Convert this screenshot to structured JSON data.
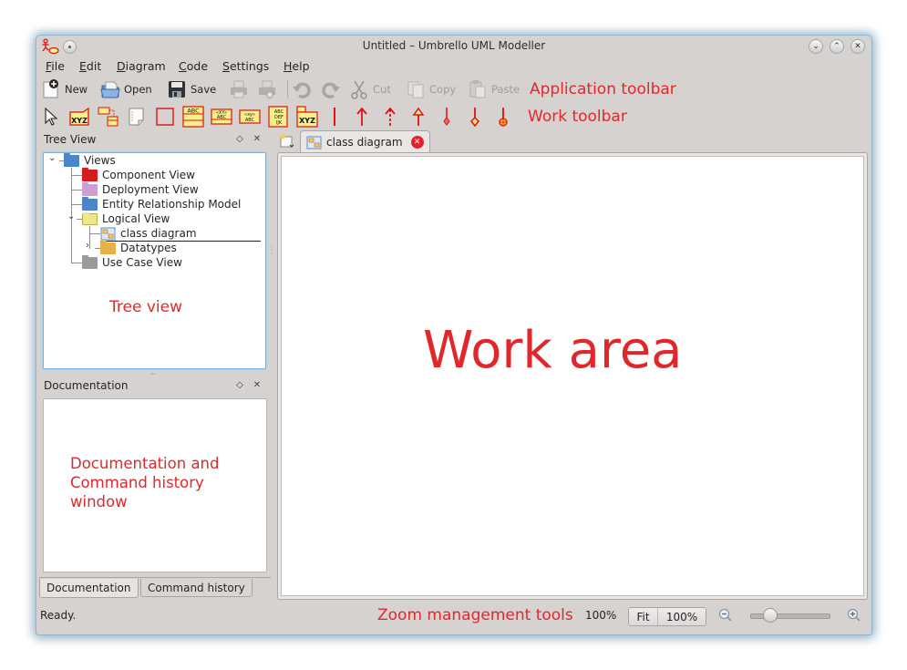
{
  "window": {
    "title": "Untitled – Umbrello UML Modeller",
    "app_icon": "umbrello-actor-icon",
    "controls": [
      "minimize-icon",
      "maximize-icon",
      "close-icon"
    ]
  },
  "menubar": {
    "items": [
      {
        "label": "File",
        "mnemonic": "F"
      },
      {
        "label": "Edit",
        "mnemonic": "E"
      },
      {
        "label": "Diagram",
        "mnemonic": "D"
      },
      {
        "label": "Code",
        "mnemonic": "C"
      },
      {
        "label": "Settings",
        "mnemonic": "S"
      },
      {
        "label": "Help",
        "mnemonic": "H"
      }
    ]
  },
  "app_toolbar": {
    "new": "New",
    "open": "Open",
    "save": "Save",
    "print": "print-icon",
    "print_preview": "print-preview-icon",
    "undo": "undo-icon",
    "redo": "redo-icon",
    "cut": "Cut",
    "copy": "Copy",
    "paste": "Paste"
  },
  "work_toolbar": {
    "tools": [
      "select-arrow",
      "object",
      "instance",
      "note",
      "box",
      "class",
      "interface",
      "datatype",
      "enum",
      "package",
      "anchor",
      "generalization",
      "realization",
      "aggregation-arrow",
      "aggregation",
      "composition",
      "containment"
    ],
    "class_text": "ABC",
    "interface_text_top": "«XY»",
    "interface_text_bottom": "ABC",
    "datatype_text_top": "«xy»",
    "datatype_text_bottom": "ABC",
    "enum_lines": [
      "ABC",
      "DEF",
      "IJK"
    ],
    "object_text": "XYZ",
    "package_text": "XYZ"
  },
  "annotations": {
    "app_toolbar": "Application toolbar",
    "work_toolbar": "Work toolbar",
    "tree_view": "Tree view",
    "work_area": "Work area",
    "documentation": "Documentation and Command history window",
    "zoom": "Zoom management tools"
  },
  "tree_view": {
    "title": "Tree View",
    "items": [
      {
        "label": "Views",
        "icon": "views-folder-icon",
        "color": "#4a86c8",
        "expanded": true
      },
      {
        "label": "Component View",
        "icon": "component-folder-icon",
        "color": "#d41c1c"
      },
      {
        "label": "Deployment View",
        "icon": "deployment-folder-icon",
        "color": "#c9a0d0"
      },
      {
        "label": "Entity Relationship Model",
        "icon": "entity-folder-icon",
        "color": "#4d86c6"
      },
      {
        "label": "Logical View",
        "icon": "logical-folder-icon",
        "color": "#efe68a",
        "expanded": true
      },
      {
        "label": "class diagram",
        "icon": "class-diagram-icon"
      },
      {
        "label": "Datatypes",
        "icon": "datatypes-folder-icon",
        "color": "#e8b04c",
        "expanded": false
      },
      {
        "label": "Use Case View",
        "icon": "usecase-folder-icon",
        "color": "#9a9a9a"
      }
    ]
  },
  "documentation_dock": {
    "title": "Documentation",
    "content": ""
  },
  "bottom_tabs": [
    {
      "label": "Documentation",
      "active": true
    },
    {
      "label": "Command history",
      "active": false
    }
  ],
  "diagram_tabs": [
    {
      "label": "class diagram",
      "active": true,
      "icon": "class-diagram-icon"
    }
  ],
  "status": {
    "text": "Ready.",
    "zoom_level": "100%",
    "fit_label": "Fit",
    "zoom_100_label": "100%",
    "zoom_slider_value_percent": 100
  },
  "colors": {
    "annotation": "#e0282c",
    "window_bg": "#d6d2d0",
    "focus_border": "#6fb4e6",
    "tool_red": "#e01010",
    "tool_yellow": "#f8f08a"
  }
}
